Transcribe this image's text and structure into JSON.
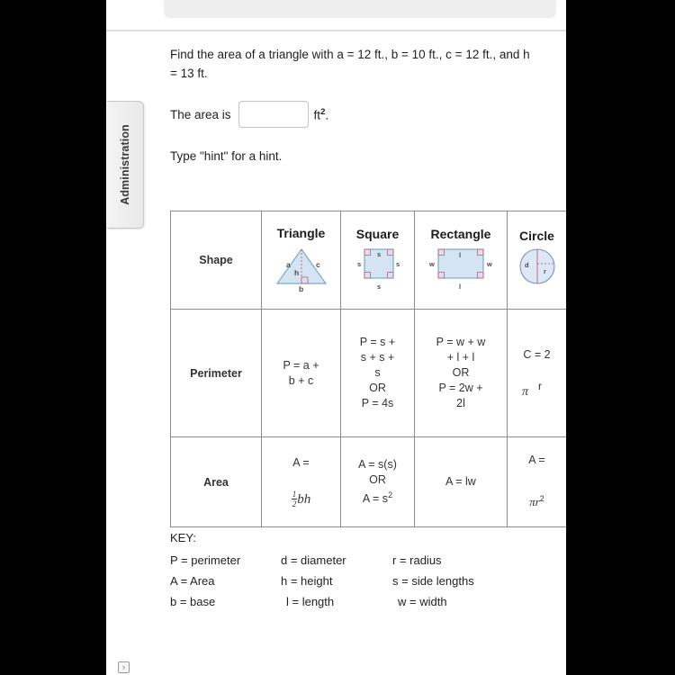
{
  "sidebar": {
    "admin_tab_label": "Administration"
  },
  "top_panel": {
    "clipped_text": ""
  },
  "question": {
    "prompt": "Find the area of a triangle with a = 12 ft., b = 10 ft., c = 12 ft., and h = 13 ft.",
    "answer_prefix": "The area is",
    "answer_value": "",
    "answer_placeholder": "",
    "answer_unit": "ft",
    "answer_unit_exponent": "2",
    "answer_unit_suffix": ".",
    "hint": "Type \"hint\" for a hint."
  },
  "table": {
    "row_labels": {
      "shape": "Shape",
      "perimeter": "Perimeter",
      "area": "Area"
    },
    "columns": [
      {
        "title": "Triangle",
        "labels": {
          "a": "a",
          "c": "c",
          "h": "h",
          "b": "b"
        }
      },
      {
        "title": "Square",
        "labels": {
          "top": "s",
          "left": "s",
          "right": "s",
          "bottom": "s"
        }
      },
      {
        "title": "Rectangle",
        "labels": {
          "top": "l",
          "left": "w",
          "right": "w",
          "bottom": "l"
        }
      },
      {
        "title": "Circle",
        "labels": {
          "d": "d",
          "r": "r"
        }
      }
    ],
    "perimeter": {
      "triangle": [
        "P = a +",
        "b + c"
      ],
      "square": [
        "P = s +",
        "s + s +",
        "s",
        "OR",
        "P = 4s"
      ],
      "rectangle": [
        "P = w + w",
        "+ l + l",
        "OR",
        "P = 2w +",
        "2l"
      ],
      "circle_line1": "C = 2",
      "circle_pi": "π",
      "circle_r": "r"
    },
    "area": {
      "triangle_line1": "A =",
      "triangle_frac_num": "1",
      "triangle_frac_den": "2",
      "triangle_bh": "bh",
      "square_line1": "A = s(s)",
      "square_or": "OR",
      "square_line2": "A = s",
      "square_exp": "2",
      "rectangle": "A = lw",
      "circle_line1": "A =",
      "circle_pi": "πr",
      "circle_exp": "2"
    }
  },
  "key": {
    "title": "KEY:",
    "rows": [
      [
        "P = perimeter",
        "d = diameter",
        "r = radius"
      ],
      [
        "A = Area",
        "h = height",
        "s = side lengths"
      ],
      [
        "b = base",
        "l = length",
        "w = width"
      ]
    ]
  },
  "footer": {
    "next_icon": "›"
  },
  "colors": {
    "shape_fill": "#d4e4f2",
    "shape_stroke": "#7fa8c9",
    "marker": "#c98fa8",
    "table_border": "#8c8c8c",
    "text": "#1f1f1f"
  }
}
